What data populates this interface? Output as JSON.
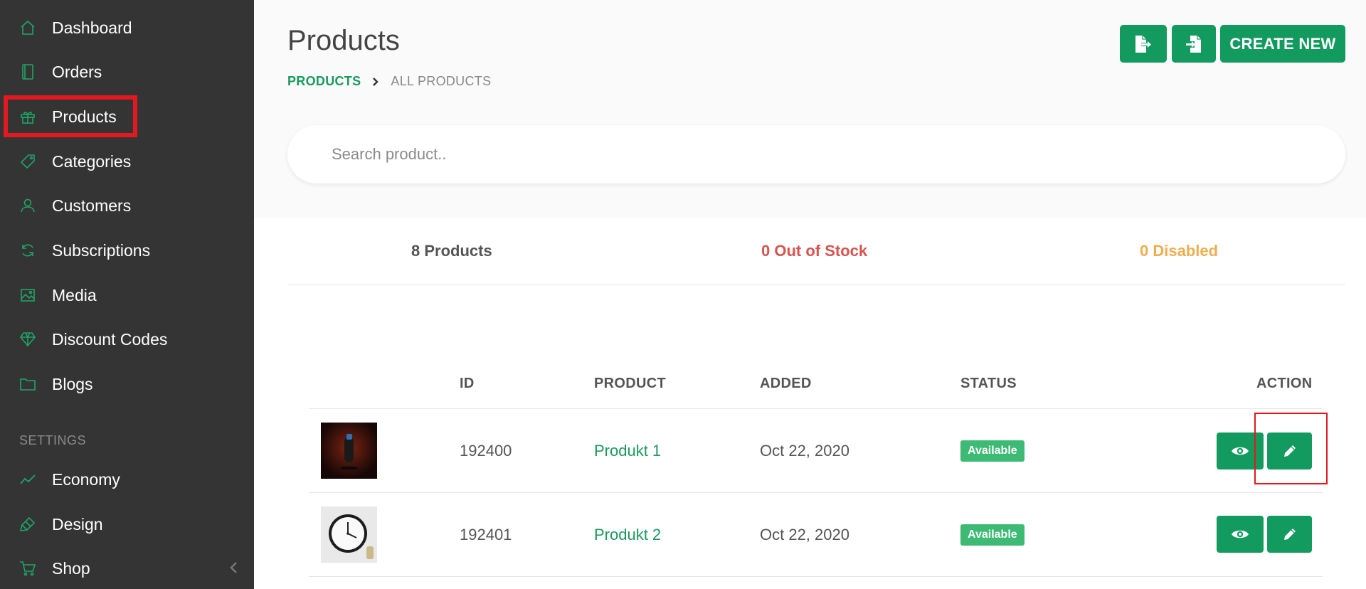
{
  "sidebar": {
    "items": [
      {
        "label": "Dashboard",
        "icon": "home-icon"
      },
      {
        "label": "Orders",
        "icon": "book-icon"
      },
      {
        "label": "Products",
        "icon": "gift-icon"
      },
      {
        "label": "Categories",
        "icon": "tag-icon"
      },
      {
        "label": "Customers",
        "icon": "user-icon"
      },
      {
        "label": "Subscriptions",
        "icon": "refresh-icon"
      },
      {
        "label": "Media",
        "icon": "image-icon"
      },
      {
        "label": "Discount Codes",
        "icon": "diamond-icon"
      },
      {
        "label": "Blogs",
        "icon": "folder-icon"
      }
    ],
    "settings_label": "SETTINGS",
    "settings_items": [
      {
        "label": "Economy",
        "icon": "trend-icon"
      },
      {
        "label": "Design",
        "icon": "brush-icon"
      },
      {
        "label": "Shop",
        "icon": "cart-icon"
      }
    ]
  },
  "header": {
    "title": "Products",
    "breadcrumb": {
      "link": "PRODUCTS",
      "current": "ALL PRODUCTS"
    },
    "create_label": "CREATE NEW"
  },
  "search": {
    "placeholder": "Search product.."
  },
  "stats": {
    "products": "8 Products",
    "out_of_stock": "0 Out of Stock",
    "disabled": "0 Disabled"
  },
  "table": {
    "headers": {
      "id": "ID",
      "product": "PRODUCT",
      "added": "ADDED",
      "status": "STATUS",
      "action": "ACTION"
    },
    "rows": [
      {
        "id": "192400",
        "product": "Produkt 1",
        "added": "Oct 22, 2020",
        "status": "Available"
      },
      {
        "id": "192401",
        "product": "Produkt 2",
        "added": "Oct 22, 2020",
        "status": "Available"
      }
    ]
  },
  "colors": {
    "accent": "#129a5f",
    "sidebar_bg": "#343434",
    "danger": "#d9534f",
    "warning": "#f0ad4e",
    "highlight": "#e3191f"
  }
}
